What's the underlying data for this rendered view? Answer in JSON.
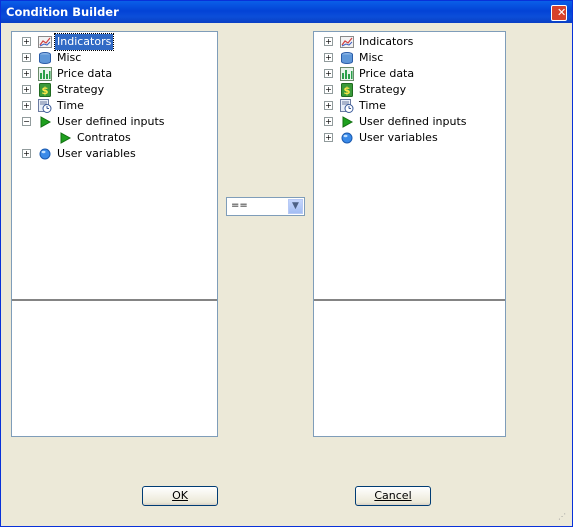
{
  "window": {
    "title": "Condition Builder",
    "close_glyph": "✕"
  },
  "left_tree": {
    "items": [
      {
        "label": "Indicators",
        "icon": "indicators-icon",
        "expander": "+",
        "selected": true
      },
      {
        "label": "Misc",
        "icon": "misc-icon",
        "expander": "+"
      },
      {
        "label": "Price data",
        "icon": "price-data-icon",
        "expander": "+"
      },
      {
        "label": "Strategy",
        "icon": "strategy-icon",
        "expander": "+"
      },
      {
        "label": "Time",
        "icon": "time-icon",
        "expander": "+"
      },
      {
        "label": "User defined inputs",
        "icon": "play-icon",
        "expander": "−"
      },
      {
        "label": "Contratos",
        "icon": "play-icon",
        "child": true
      },
      {
        "label": "User variables",
        "icon": "globe-icon",
        "expander": "+"
      }
    ]
  },
  "right_tree": {
    "items": [
      {
        "label": "Indicators",
        "icon": "indicators-icon",
        "expander": "+"
      },
      {
        "label": "Misc",
        "icon": "misc-icon",
        "expander": "+"
      },
      {
        "label": "Price data",
        "icon": "price-data-icon",
        "expander": "+"
      },
      {
        "label": "Strategy",
        "icon": "strategy-icon",
        "expander": "+"
      },
      {
        "label": "Time",
        "icon": "time-icon",
        "expander": "+"
      },
      {
        "label": "User defined inputs",
        "icon": "play-icon",
        "expander": "+"
      },
      {
        "label": "User variables",
        "icon": "globe-icon",
        "expander": "+"
      }
    ]
  },
  "operator": {
    "value": "=="
  },
  "buttons": {
    "ok": "OK",
    "cancel": "Cancel"
  },
  "colors": {
    "title_bar": "#0a4fd8",
    "dialog_bg": "#ece9d8",
    "selection": "#316ac5"
  }
}
